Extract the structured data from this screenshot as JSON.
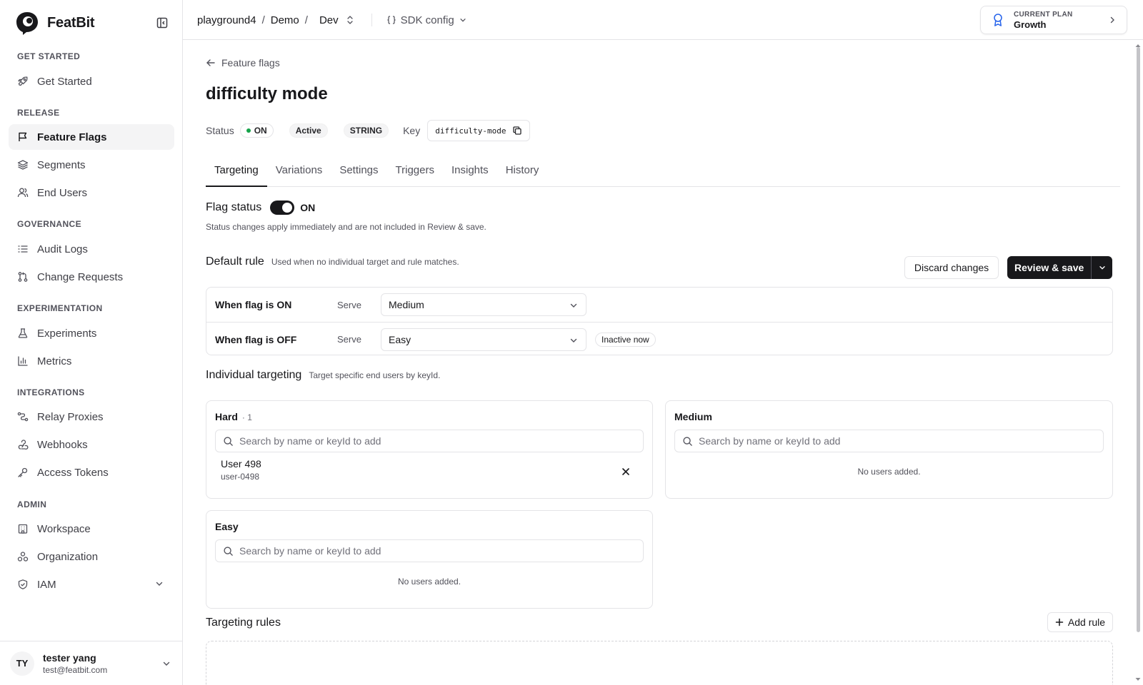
{
  "brand": {
    "name": "FeatBit"
  },
  "sidebar": {
    "sections": [
      {
        "label": "GET STARTED"
      },
      {
        "label": "RELEASE"
      },
      {
        "label": "GOVERNANCE"
      },
      {
        "label": "EXPERIMENTATION"
      },
      {
        "label": "INTEGRATIONS"
      },
      {
        "label": "ADMIN"
      }
    ],
    "items": [
      {
        "label": "Get Started",
        "icon": "rocket-icon"
      },
      {
        "label": "Feature Flags",
        "icon": "flag-icon",
        "active": true
      },
      {
        "label": "Segments",
        "icon": "layers-icon"
      },
      {
        "label": "End Users",
        "icon": "users-icon"
      },
      {
        "label": "Audit Logs",
        "icon": "list-icon"
      },
      {
        "label": "Change Requests",
        "icon": "git-pull-request-icon"
      },
      {
        "label": "Experiments",
        "icon": "flask-icon"
      },
      {
        "label": "Metrics",
        "icon": "bar-chart-icon"
      },
      {
        "label": "Relay Proxies",
        "icon": "relay-icon"
      },
      {
        "label": "Webhooks",
        "icon": "webhook-icon"
      },
      {
        "label": "Access Tokens",
        "icon": "key-icon"
      },
      {
        "label": "Workspace",
        "icon": "building-icon"
      },
      {
        "label": "Organization",
        "icon": "organization-icon"
      },
      {
        "label": "IAM",
        "icon": "shield-icon"
      }
    ],
    "user": {
      "initials": "TY",
      "name": "tester yang",
      "email": "test@featbit.com"
    }
  },
  "topbar": {
    "breadcrumb": [
      "playground4",
      "Demo",
      "Dev"
    ],
    "separator": "/",
    "sdk_config": "SDK config",
    "plan": {
      "label": "CURRENT PLAN",
      "name": "Growth"
    }
  },
  "page": {
    "back_label": "Feature flags",
    "title": "difficulty mode",
    "status_label": "Status",
    "status_value": "ON",
    "active_badge": "Active",
    "type_badge": "STRING",
    "key_label": "Key",
    "key_value": "difficulty-mode",
    "tabs": [
      "Targeting",
      "Variations",
      "Settings",
      "Triggers",
      "Insights",
      "History"
    ],
    "active_tab": "Targeting"
  },
  "flag_status": {
    "title": "Flag status",
    "toggle_on": true,
    "toggle_label": "ON",
    "note": "Status changes apply immediately and are not included in Review & save."
  },
  "default_rule": {
    "title": "Default rule",
    "subtitle": "Used when no individual target and rule matches.",
    "discard_label": "Discard changes",
    "review_label": "Review & save",
    "rows": [
      {
        "label": "When flag is ON",
        "serve": "Serve",
        "value": "Medium"
      },
      {
        "label": "When flag is OFF",
        "serve": "Serve",
        "value": "Easy",
        "badge": "Inactive now"
      }
    ]
  },
  "individual_targeting": {
    "title": "Individual targeting",
    "subtitle": "Target specific end users by keyId.",
    "search_placeholder": "Search by name or keyId to add",
    "empty_text": "No users added.",
    "cards": [
      {
        "name": "Hard",
        "count": "· 1",
        "users": [
          {
            "name": "User 498",
            "key": "user-0498"
          }
        ]
      },
      {
        "name": "Medium",
        "count": "",
        "users": []
      },
      {
        "name": "Easy",
        "count": "",
        "users": []
      }
    ]
  },
  "targeting_rules": {
    "title": "Targeting rules",
    "add_label": "Add rule"
  },
  "colors": {
    "accent": "#18181b",
    "status_on": "#16a34a",
    "border": "#e4e4e7",
    "muted_text": "#52525b"
  }
}
